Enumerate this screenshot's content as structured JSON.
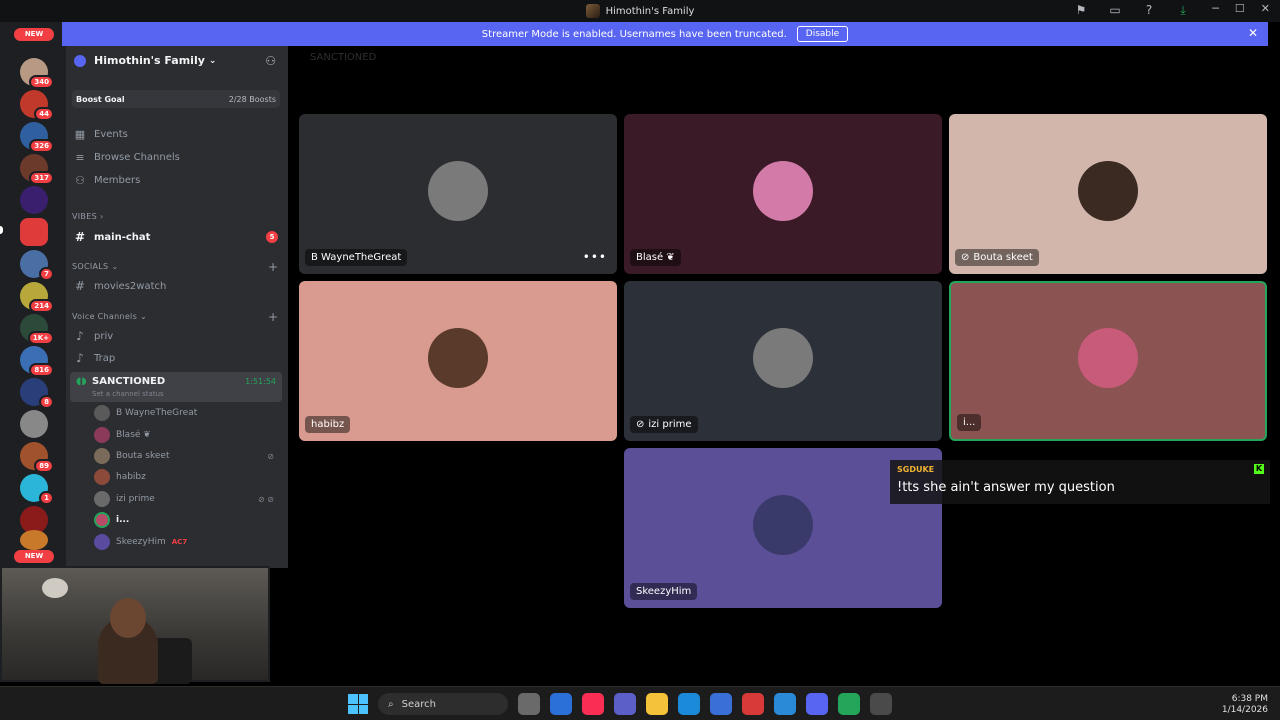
{
  "window": {
    "title": "Himothin's Family"
  },
  "banner": {
    "text": "Streamer Mode is enabled. Usernames have been truncated.",
    "button": "Disable"
  },
  "rail": {
    "new_top": "NEW",
    "new_bottom": "NEW",
    "servers": [
      {
        "badge": "340",
        "color": "#b89a84"
      },
      {
        "badge": "44",
        "color": "#c0392b"
      },
      {
        "badge": "326",
        "color": "#2f5f9e"
      },
      {
        "badge": "317",
        "color": "#6b3a2b"
      },
      {
        "badge": "",
        "color": "#3a1f6e"
      },
      {
        "badge": "",
        "color": "#e03b3b"
      },
      {
        "badge": "7",
        "color": "#4a6fa5"
      },
      {
        "badge": "214",
        "color": "#b8a83b"
      },
      {
        "badge": "1K+",
        "color": "#2b4a3a"
      },
      {
        "badge": "816",
        "color": "#3b6fb5"
      },
      {
        "badge": "8",
        "color": "#2a3e7a"
      },
      {
        "badge": "",
        "color": "#888888"
      },
      {
        "badge": "89",
        "color": "#a0522d"
      },
      {
        "badge": "1",
        "color": "#2bb5d8"
      },
      {
        "badge": "",
        "color": "#8b1a1a"
      },
      {
        "badge": "",
        "color": "#c87a2a"
      }
    ]
  },
  "sidebar": {
    "server_name": "Himothin's Family",
    "boost_label": "Boost Goal",
    "boost_count": "2/28 Boosts",
    "nav": [
      {
        "label": "Events",
        "icon": "calendar-icon"
      },
      {
        "label": "Browse Channels",
        "icon": "browse-icon"
      },
      {
        "label": "Members",
        "icon": "members-icon"
      }
    ],
    "cat_vibes": "VIBES",
    "main_chat": "main-chat",
    "main_chat_unread": "5",
    "cat_socials": "SOCIALS",
    "movies": "movies2watch",
    "cat_voice": "Voice Channels",
    "voice_channels": [
      "priv",
      "Trap"
    ],
    "active_voice": {
      "name": "SANCTIONED",
      "status": "Set a channel status",
      "timer": "1:51:54"
    },
    "voice_users": [
      {
        "name": "B WayneTheGreat",
        "color": "#5a5a5a"
      },
      {
        "name": "Blasé ❦",
        "color": "#8b3a5a"
      },
      {
        "name": "Bouta skeet",
        "color": "#7a6a5a"
      },
      {
        "name": "habibz",
        "color": "#8b4a3a"
      },
      {
        "name": "izi prime",
        "color": "#6a6a6a"
      },
      {
        "name": "i...",
        "color": "#b84a6a"
      },
      {
        "name": "SkeezyHim",
        "color": "#5a4aa0",
        "live": "AC7"
      }
    ]
  },
  "stage": {
    "channel_title": "SANCTIONED",
    "tiles": [
      {
        "name": "B WayneTheGreat",
        "bg": "#2b2d31",
        "avatar": "#7a7a7a"
      },
      {
        "name": "Blasé ❦",
        "bg": "#3b1a27",
        "avatar": "#d27aa8"
      },
      {
        "name": "Bouta skeet",
        "bg": "#d2b6ac",
        "avatar": "#3a2a22",
        "muted": true
      },
      {
        "name": "habibz",
        "bg": "#d99b90",
        "avatar": "#5a3a2a"
      },
      {
        "name": "izi prime",
        "bg": "#2c3038",
        "avatar": "#7a7a7a",
        "muted": true
      },
      {
        "name": "i...",
        "bg": "#8b5453",
        "avatar": "#c85a7a",
        "speaking": true
      },
      {
        "name": "SkeezyHim",
        "bg": "#5b4f98",
        "avatar": "#3a3a6a"
      }
    ]
  },
  "chat_overlay": {
    "user": "SGDUKE",
    "message": "!tts she ain't answer my question"
  },
  "taskbar": {
    "search": "Search",
    "time": "6:38 PM",
    "date": "1/14/2026"
  }
}
